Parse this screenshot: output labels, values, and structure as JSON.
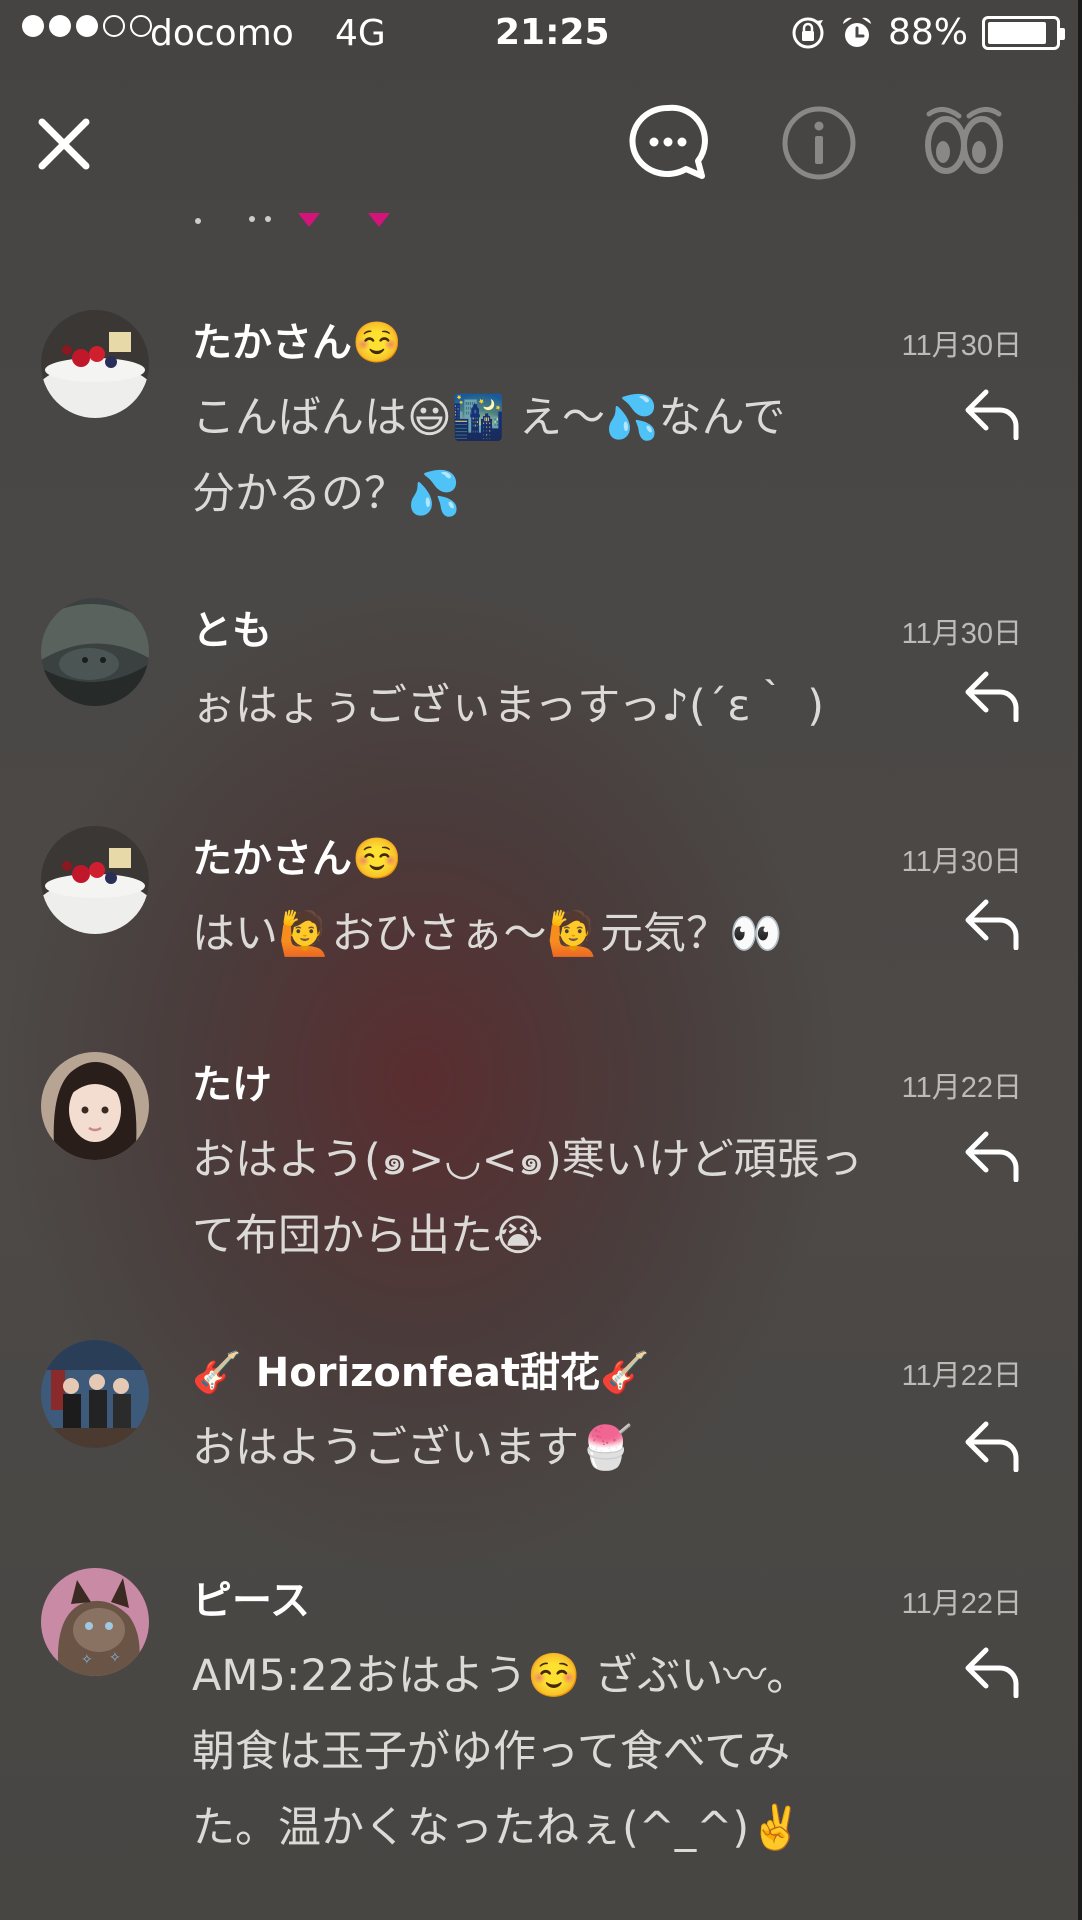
{
  "status": {
    "carrier": "docomo",
    "network": "4G",
    "time": "21:25",
    "battery": "88%",
    "battery_level": 0.88,
    "signal_bars": 3,
    "signal_total": 5
  },
  "toolbar": {
    "close_icon": "close-icon",
    "chat_icon": "chat-bubble-icon",
    "info_icon": "info-icon",
    "eyes_icon": "eyes-icon"
  },
  "messages": [
    {
      "name": "たかさん☺️",
      "date": "11月30日",
      "text": "こんばんは😃🌃 え〜💦なんで\n分かるの？💦"
    },
    {
      "name": "とも",
      "date": "11月30日",
      "text": "ぉはょぅござぃまっすっ♪(´ε｀ )"
    },
    {
      "name": "たかさん☺️",
      "date": "11月30日",
      "text": "はい🙋おひさぁ〜🙋元気？👀"
    },
    {
      "name": "たけ",
      "date": "11月22日",
      "text": "おはよう(๑>◡<๑)寒いけど頑張っ\nて布団から出た😭"
    },
    {
      "name": "🎸 Horizonfeat甜花🎸",
      "date": "11月22日",
      "text": "おはようございます🍧"
    },
    {
      "name": "ピース",
      "date": "11月22日",
      "text": "AM5:22おはよう☺️ ざぶい〰。\n朝食は玉子がゆ作って食べてみ\nた。温かくなったねぇ(^_^)✌️"
    }
  ]
}
